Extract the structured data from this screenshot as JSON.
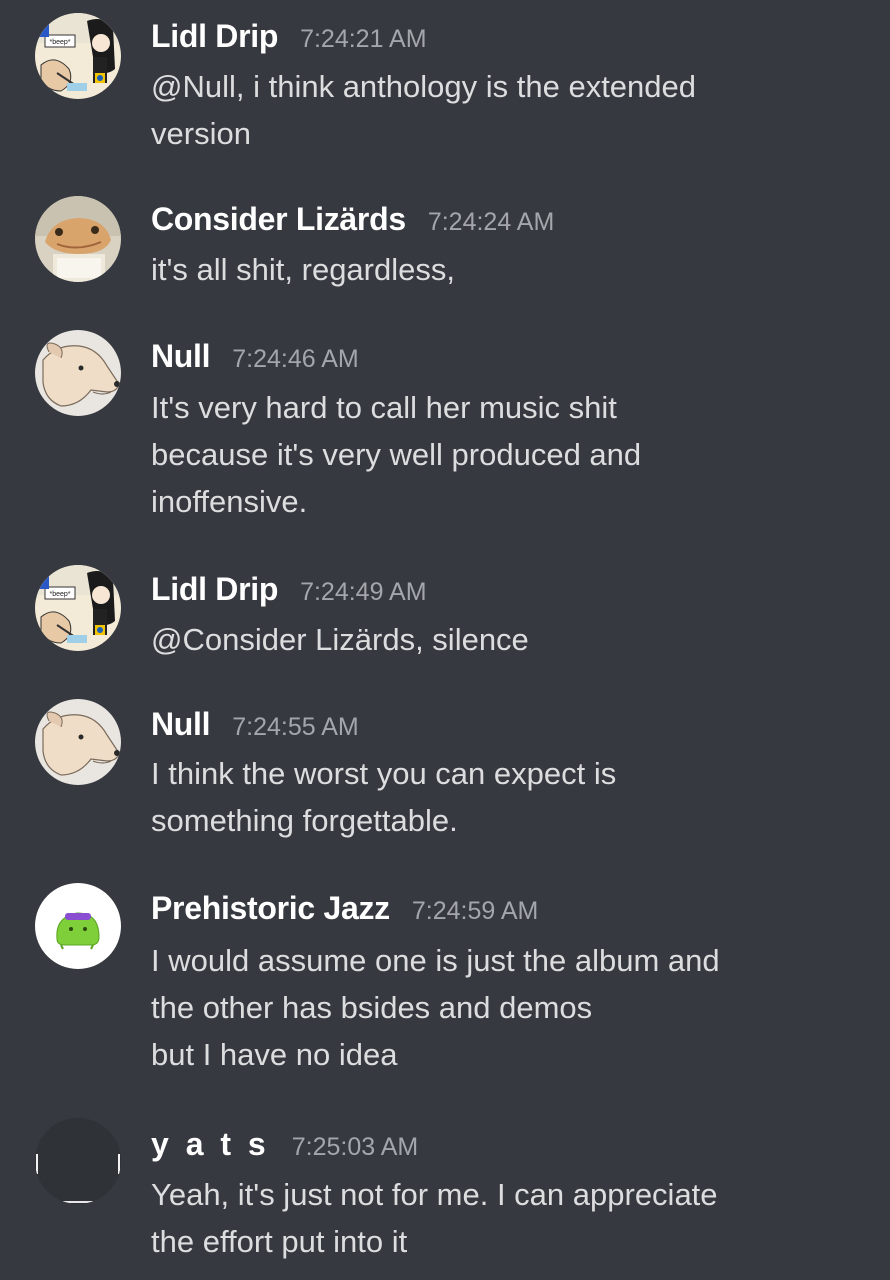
{
  "messages": [
    {
      "author": "Lidl Drip",
      "time": "7:24:21 AM",
      "lines": [
        "@Null, i think anthology is the extended",
        "version"
      ]
    },
    {
      "author": "Consider Lizärds",
      "time": "7:24:24 AM",
      "lines": [
        "it's all shit, regardless,"
      ]
    },
    {
      "author": "Null",
      "time": "7:24:46 AM",
      "lines": [
        "It's very hard to call her music shit",
        "because it's very well produced and",
        "inoffensive."
      ]
    },
    {
      "author": "Lidl Drip",
      "time": "7:24:49 AM",
      "lines": [
        "@Consider Lizärds, silence"
      ]
    },
    {
      "author": "Null",
      "time": "7:24:55 AM",
      "lines": [
        "I think the worst you can expect is",
        "something forgettable."
      ]
    },
    {
      "author": "Prehistoric Jazz",
      "time": "7:24:59 AM",
      "lines": [
        "I would assume one is just the album and",
        "the other has bsides and demos",
        "but I have no idea"
      ]
    },
    {
      "author": "y a t s",
      "time": "7:25:03 AM",
      "lines": [
        "Yeah, it's just not for me. I can appreciate",
        "the effort put into it"
      ]
    }
  ],
  "avatars": {
    "lidl_drip_badge": "*beep*"
  },
  "colors": {
    "background": "#36393f",
    "author": "#ffffff",
    "timestamp": "#a3a6aa",
    "text": "#dcddde"
  }
}
